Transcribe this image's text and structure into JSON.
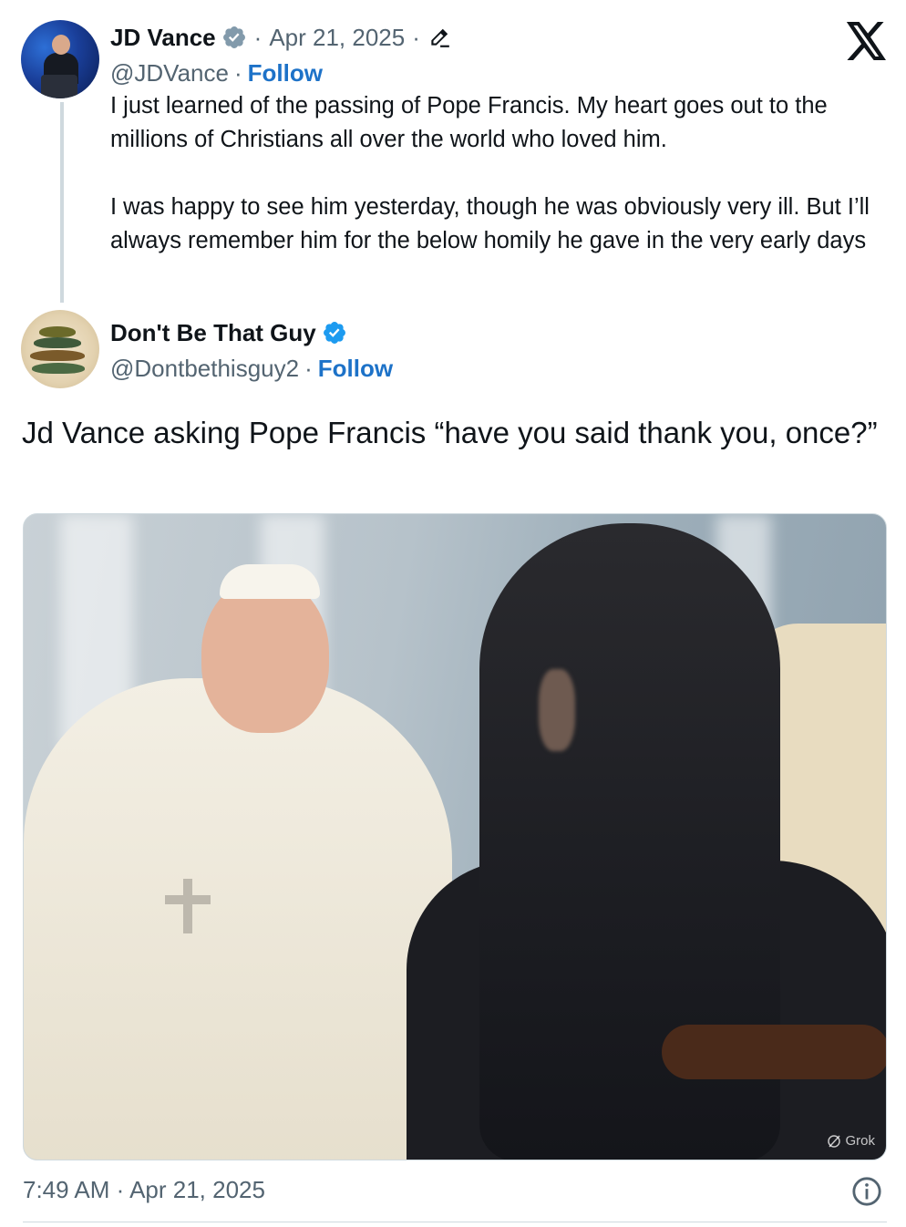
{
  "quoted_tweet": {
    "author_name": "JD Vance",
    "date": "Apr 21, 2025",
    "handle": "@JDVance",
    "follow_label": "Follow",
    "text_para1": "I just learned of the passing of Pope Francis. My heart goes out to the millions of Christians all over the world who loved him.",
    "text_para2": "I was happy to see him yesterday, though he was obviously very ill. But I’ll always remember him for the below homily he gave in the very early days"
  },
  "tweet": {
    "author_name": "Don't Be That Guy",
    "handle": "@Dontbethisguy2",
    "follow_label": "Follow",
    "text": "Jd Vance asking Pope Francis “have you said thank you, once?”",
    "media_watermark": "Grok",
    "timestamp": "7:49 AM · Apr 21, 2025"
  },
  "separators": {
    "dot": "·"
  },
  "colors": {
    "link": "#1d72c8",
    "secondary_text": "#536471",
    "verified_badge": "#1d9bf0",
    "verified_badge_gray": "#829aab"
  },
  "icons": {
    "brand": "x-logo-icon",
    "verified": "verified-badge-icon",
    "edited": "pencil-icon",
    "info": "info-icon",
    "watermark": "grok-icon"
  }
}
